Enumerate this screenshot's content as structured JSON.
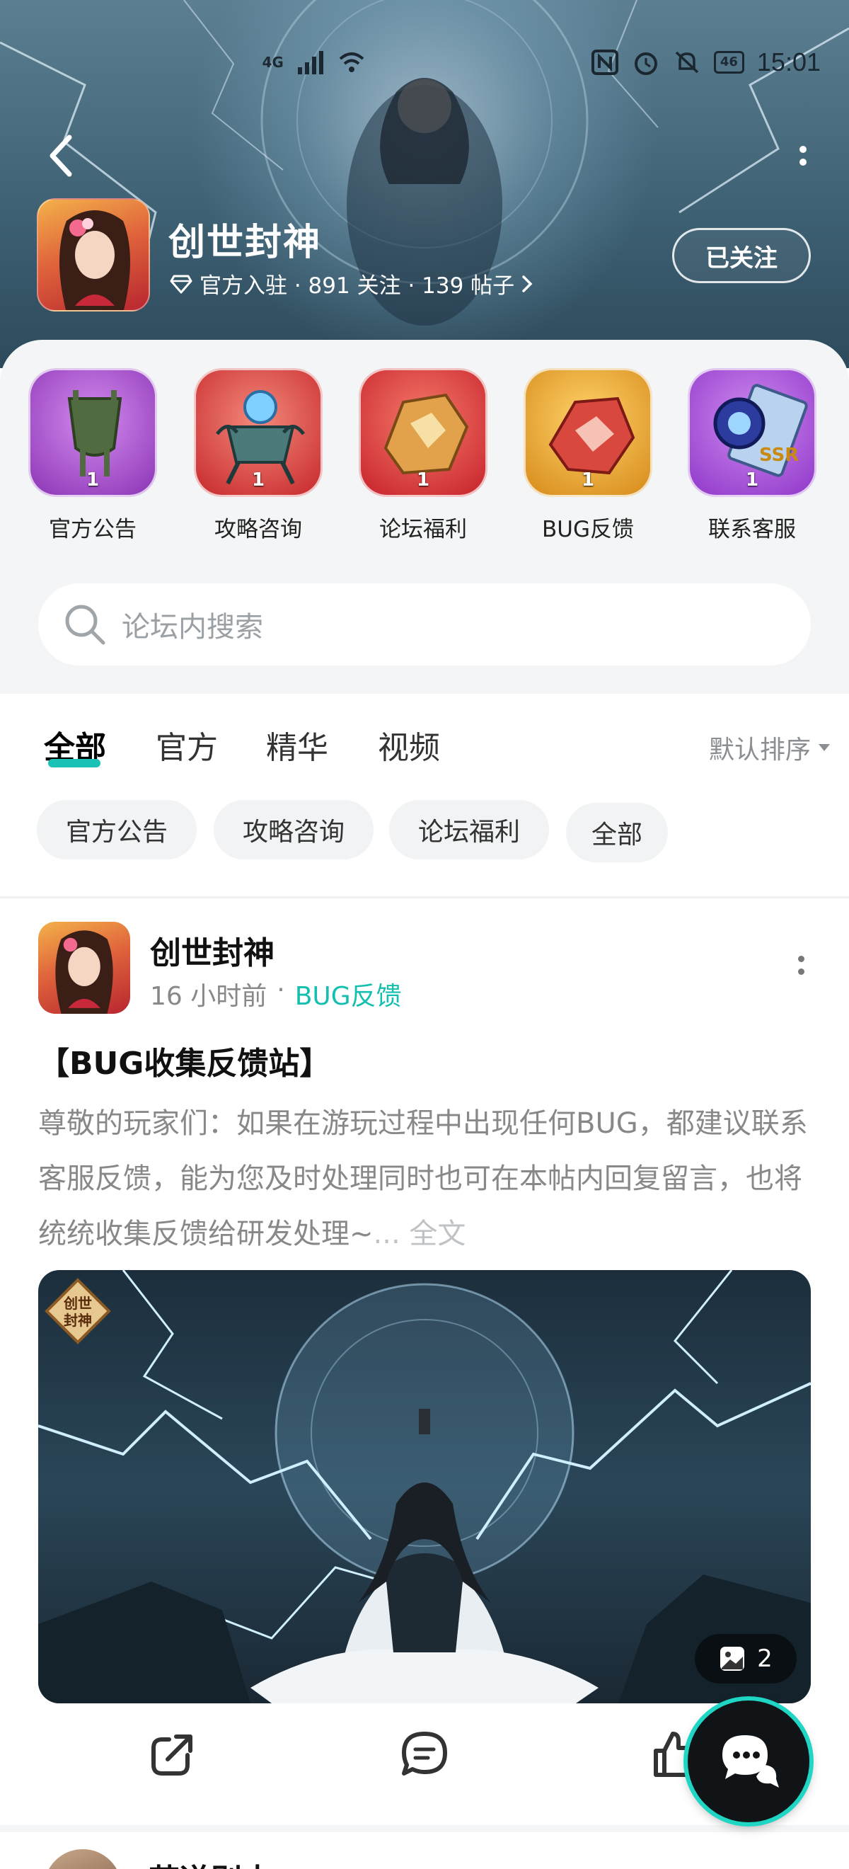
{
  "status_bar": {
    "network": "4G",
    "battery": "46",
    "time": "15:01"
  },
  "game": {
    "title": "创世封神",
    "meta": "官方入驻 · 891 关注 · 139 帖子",
    "follow_label": "已关注"
  },
  "categories": [
    {
      "label": "官方公告",
      "count": "1",
      "icon": "bronze-vessel-icon",
      "color": "#a64fc9"
    },
    {
      "label": "攻略咨询",
      "count": "1",
      "icon": "cauldron-icon",
      "color": "#d8453e"
    },
    {
      "label": "论坛福利",
      "count": "1",
      "icon": "gold-ore-icon",
      "color": "#e24b3d"
    },
    {
      "label": "BUG反馈",
      "count": "1",
      "icon": "red-crystal-icon",
      "color": "#e59a2a"
    },
    {
      "label": "联系客服",
      "count": "1",
      "icon": "ssr-ticket-icon",
      "color": "#9a44d1"
    }
  ],
  "search": {
    "placeholder": "论坛内搜索"
  },
  "tabs": [
    {
      "label": "全部",
      "active": true
    },
    {
      "label": "官方",
      "active": false
    },
    {
      "label": "精华",
      "active": false
    },
    {
      "label": "视频",
      "active": false
    }
  ],
  "sort_label": "默认排序",
  "filter_chips": [
    "官方公告",
    "攻略咨询",
    "论坛福利",
    "全部"
  ],
  "post": {
    "author": "创世封神",
    "time": "16 小时前",
    "separator": "·",
    "tag": "BUG反馈",
    "title": "【BUG收集反馈站】",
    "body": "尊敬的玩家们：如果在游玩过程中出现任何BUG，都建议联系客服反馈，能为您及时处理同时也可在本帖内回复留言，也将统统收集反馈给研发处理~",
    "more_label": "... 全文",
    "image_count": "2",
    "image_logo": "创世\n封神"
  },
  "next_post": {
    "author": "苏遂别夫"
  },
  "colors": {
    "accent": "#19c2b4",
    "tag": "#15bfb0"
  }
}
